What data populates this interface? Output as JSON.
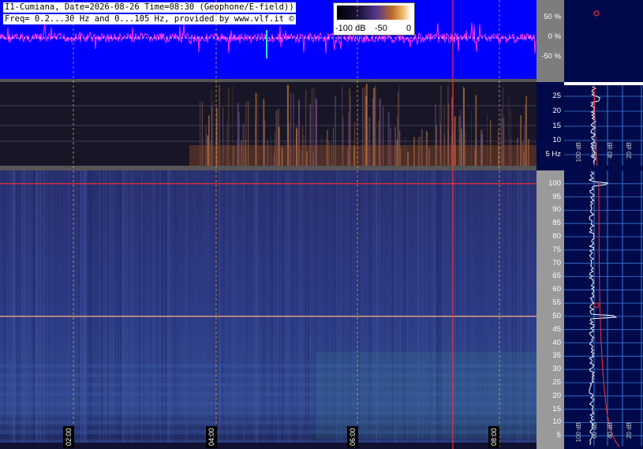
{
  "header": {
    "line1": "I1-Cumiana, Date=2026-08-26 Time=08:30 (Geophone/E-field))",
    "line2": "Freq= 0.2...30 Hz and 0...105 Hz, provided by www.vlf.it ©"
  },
  "colorbar": {
    "labels": [
      "-100 dB",
      "-50",
      "0"
    ]
  },
  "amplitude_scale": [
    "50 %",
    "0 %",
    "-50 %"
  ],
  "elf_scale": [
    "25",
    "20",
    "15",
    "10",
    "5 Hz"
  ],
  "slf_scale": [
    "100",
    "95",
    "90",
    "85",
    "80",
    "75",
    "70",
    "65",
    "60",
    "55",
    "50",
    "45",
    "40",
    "35",
    "30",
    "25",
    "20",
    "15",
    "10",
    "5"
  ],
  "time_labels": [
    "02:00",
    "04:00",
    "06:00",
    "08:00"
  ],
  "side_db_labels_upper": [
    "100 dB",
    "60 dB",
    "40 dB",
    "20 dB"
  ],
  "side_db_labels_lower": [
    "100 dB",
    "60 dB",
    "40 dB",
    "20 dB"
  ],
  "colors": {
    "waveform_bg": "#0000ff",
    "waveform": "#ff33ff",
    "spectrogram_bg": "#23307a",
    "grid_dash": "#e8a050",
    "marker_line": "#ff3030",
    "side_bg": "#000a4a",
    "side_grid": "#3a7ad8"
  },
  "chart_data": [
    {
      "type": "line",
      "title": "",
      "xlabel": "",
      "ylabel": "",
      "ylim": [
        -100,
        100
      ],
      "yticks": [
        50,
        0,
        -50
      ],
      "note_values": "waveform amplitude percent over time"
    },
    {
      "type": "heatmap",
      "title": "",
      "ylim": [
        0,
        30
      ],
      "yticks": [
        25,
        20,
        15,
        10,
        5
      ],
      "xticks": [
        "02:00",
        "04:00",
        "06:00",
        "08:00"
      ]
    },
    {
      "type": "heatmap",
      "title": "",
      "ylim": [
        0,
        105
      ],
      "yticks": [
        100,
        95,
        90,
        85,
        80,
        75,
        70,
        65,
        60,
        55,
        50,
        45,
        40,
        35,
        30,
        25,
        20,
        15,
        10,
        5
      ],
      "xticks": [
        "02:00",
        "04:00",
        "06:00",
        "08:00"
      ],
      "highlighted_lines_hz": [
        50,
        100
      ]
    }
  ]
}
